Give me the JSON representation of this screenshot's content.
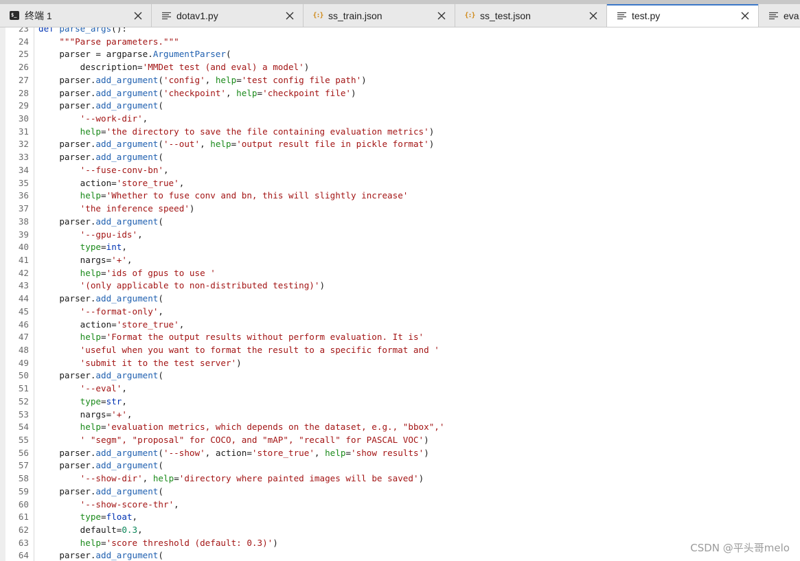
{
  "tabs": [
    {
      "label": "终端 1",
      "icon": "terminal-icon",
      "active": false
    },
    {
      "label": "dotav1.py",
      "icon": "text-file-icon",
      "active": false
    },
    {
      "label": "ss_train.json",
      "icon": "json-file-icon",
      "active": false
    },
    {
      "label": "ss_test.json",
      "icon": "json-file-icon",
      "active": false
    },
    {
      "label": "test.py",
      "icon": "text-file-icon",
      "active": true
    },
    {
      "label": "eva",
      "icon": "text-file-icon",
      "active": false
    }
  ],
  "colors": {
    "keyword": "#0033b3",
    "string": "#a31515",
    "method": "#2060b0",
    "argname": "#1b8a1b",
    "number": "#098658",
    "accent": "#3c78c8"
  },
  "code_lines": [
    {
      "n": "23",
      "t": [
        [
          "kw",
          "def"
        ],
        [
          "txt",
          " "
        ],
        [
          "fn",
          "parse_args"
        ],
        [
          "txt",
          "():"
        ]
      ]
    },
    {
      "n": "24",
      "t": [
        [
          "txt",
          "    "
        ],
        [
          "str",
          "\"\"\"Parse parameters.\"\"\""
        ]
      ]
    },
    {
      "n": "25",
      "t": [
        [
          "txt",
          "    parser = argparse."
        ],
        [
          "fn",
          "ArgumentParser"
        ],
        [
          "txt",
          "("
        ]
      ]
    },
    {
      "n": "26",
      "t": [
        [
          "txt",
          "        description="
        ],
        [
          "str",
          "'MMDet test (and eval) a model'"
        ],
        [
          "txt",
          ")"
        ]
      ]
    },
    {
      "n": "27",
      "t": [
        [
          "txt",
          "    parser."
        ],
        [
          "fn",
          "add_argument"
        ],
        [
          "txt",
          "("
        ],
        [
          "str",
          "'config'"
        ],
        [
          "txt",
          ", "
        ],
        [
          "arg",
          "help"
        ],
        [
          "txt",
          "="
        ],
        [
          "str",
          "'test config file path'"
        ],
        [
          "txt",
          ")"
        ]
      ]
    },
    {
      "n": "28",
      "t": [
        [
          "txt",
          "    parser."
        ],
        [
          "fn",
          "add_argument"
        ],
        [
          "txt",
          "("
        ],
        [
          "str",
          "'checkpoint'"
        ],
        [
          "txt",
          ", "
        ],
        [
          "arg",
          "help"
        ],
        [
          "txt",
          "="
        ],
        [
          "str",
          "'checkpoint file'"
        ],
        [
          "txt",
          ")"
        ]
      ]
    },
    {
      "n": "29",
      "t": [
        [
          "txt",
          "    parser."
        ],
        [
          "fn",
          "add_argument"
        ],
        [
          "txt",
          "("
        ]
      ]
    },
    {
      "n": "30",
      "t": [
        [
          "txt",
          "        "
        ],
        [
          "str",
          "'--work-dir'"
        ],
        [
          "txt",
          ","
        ]
      ]
    },
    {
      "n": "31",
      "t": [
        [
          "txt",
          "        "
        ],
        [
          "arg",
          "help"
        ],
        [
          "txt",
          "="
        ],
        [
          "str",
          "'the directory to save the file containing evaluation metrics'"
        ],
        [
          "txt",
          ")"
        ]
      ]
    },
    {
      "n": "32",
      "t": [
        [
          "txt",
          "    parser."
        ],
        [
          "fn",
          "add_argument"
        ],
        [
          "txt",
          "("
        ],
        [
          "str",
          "'--out'"
        ],
        [
          "txt",
          ", "
        ],
        [
          "arg",
          "help"
        ],
        [
          "txt",
          "="
        ],
        [
          "str",
          "'output result file in pickle format'"
        ],
        [
          "txt",
          ")"
        ]
      ]
    },
    {
      "n": "33",
      "t": [
        [
          "txt",
          "    parser."
        ],
        [
          "fn",
          "add_argument"
        ],
        [
          "txt",
          "("
        ]
      ]
    },
    {
      "n": "34",
      "t": [
        [
          "txt",
          "        "
        ],
        [
          "str",
          "'--fuse-conv-bn'"
        ],
        [
          "txt",
          ","
        ]
      ]
    },
    {
      "n": "35",
      "t": [
        [
          "txt",
          "        action="
        ],
        [
          "str",
          "'store_true'"
        ],
        [
          "txt",
          ","
        ]
      ]
    },
    {
      "n": "36",
      "t": [
        [
          "txt",
          "        "
        ],
        [
          "arg",
          "help"
        ],
        [
          "txt",
          "="
        ],
        [
          "str",
          "'Whether to fuse conv and bn, this will slightly increase'"
        ]
      ]
    },
    {
      "n": "37",
      "t": [
        [
          "txt",
          "        "
        ],
        [
          "str",
          "'the inference speed'"
        ],
        [
          "txt",
          ")"
        ]
      ]
    },
    {
      "n": "38",
      "t": [
        [
          "txt",
          "    parser."
        ],
        [
          "fn",
          "add_argument"
        ],
        [
          "txt",
          "("
        ]
      ]
    },
    {
      "n": "39",
      "t": [
        [
          "txt",
          "        "
        ],
        [
          "str",
          "'--gpu-ids'"
        ],
        [
          "txt",
          ","
        ]
      ]
    },
    {
      "n": "40",
      "t": [
        [
          "txt",
          "        "
        ],
        [
          "arg",
          "type"
        ],
        [
          "txt",
          "="
        ],
        [
          "kw",
          "int"
        ],
        [
          "txt",
          ","
        ]
      ]
    },
    {
      "n": "41",
      "t": [
        [
          "txt",
          "        nargs="
        ],
        [
          "str",
          "'+'"
        ],
        [
          "txt",
          ","
        ]
      ]
    },
    {
      "n": "42",
      "t": [
        [
          "txt",
          "        "
        ],
        [
          "arg",
          "help"
        ],
        [
          "txt",
          "="
        ],
        [
          "str",
          "'ids of gpus to use '"
        ]
      ]
    },
    {
      "n": "43",
      "t": [
        [
          "txt",
          "        "
        ],
        [
          "str",
          "'(only applicable to non-distributed testing)'"
        ],
        [
          "txt",
          ")"
        ]
      ]
    },
    {
      "n": "44",
      "t": [
        [
          "txt",
          "    parser."
        ],
        [
          "fn",
          "add_argument"
        ],
        [
          "txt",
          "("
        ]
      ]
    },
    {
      "n": "45",
      "t": [
        [
          "txt",
          "        "
        ],
        [
          "str",
          "'--format-only'"
        ],
        [
          "txt",
          ","
        ]
      ]
    },
    {
      "n": "46",
      "t": [
        [
          "txt",
          "        action="
        ],
        [
          "str",
          "'store_true'"
        ],
        [
          "txt",
          ","
        ]
      ]
    },
    {
      "n": "47",
      "t": [
        [
          "txt",
          "        "
        ],
        [
          "arg",
          "help"
        ],
        [
          "txt",
          "="
        ],
        [
          "str",
          "'Format the output results without perform evaluation. It is'"
        ]
      ]
    },
    {
      "n": "48",
      "t": [
        [
          "txt",
          "        "
        ],
        [
          "str",
          "'useful when you want to format the result to a specific format and '"
        ]
      ]
    },
    {
      "n": "49",
      "t": [
        [
          "txt",
          "        "
        ],
        [
          "str",
          "'submit it to the test server'"
        ],
        [
          "txt",
          ")"
        ]
      ]
    },
    {
      "n": "50",
      "t": [
        [
          "txt",
          "    parser."
        ],
        [
          "fn",
          "add_argument"
        ],
        [
          "txt",
          "("
        ]
      ]
    },
    {
      "n": "51",
      "t": [
        [
          "txt",
          "        "
        ],
        [
          "str",
          "'--eval'"
        ],
        [
          "txt",
          ","
        ]
      ]
    },
    {
      "n": "52",
      "t": [
        [
          "txt",
          "        "
        ],
        [
          "arg",
          "type"
        ],
        [
          "txt",
          "="
        ],
        [
          "kw",
          "str"
        ],
        [
          "txt",
          ","
        ]
      ]
    },
    {
      "n": "53",
      "t": [
        [
          "txt",
          "        nargs="
        ],
        [
          "str",
          "'+'"
        ],
        [
          "txt",
          ","
        ]
      ]
    },
    {
      "n": "54",
      "t": [
        [
          "txt",
          "        "
        ],
        [
          "arg",
          "help"
        ],
        [
          "txt",
          "="
        ],
        [
          "str",
          "'evaluation metrics, which depends on the dataset, e.g., \"bbox\",'"
        ]
      ]
    },
    {
      "n": "55",
      "t": [
        [
          "txt",
          "        "
        ],
        [
          "str",
          "' \"segm\", \"proposal\" for COCO, and \"mAP\", \"recall\" for PASCAL VOC'"
        ],
        [
          "txt",
          ")"
        ]
      ]
    },
    {
      "n": "56",
      "t": [
        [
          "txt",
          "    parser."
        ],
        [
          "fn",
          "add_argument"
        ],
        [
          "txt",
          "("
        ],
        [
          "str",
          "'--show'"
        ],
        [
          "txt",
          ", action="
        ],
        [
          "str",
          "'store_true'"
        ],
        [
          "txt",
          ", "
        ],
        [
          "arg",
          "help"
        ],
        [
          "txt",
          "="
        ],
        [
          "str",
          "'show results'"
        ],
        [
          "txt",
          ")"
        ]
      ]
    },
    {
      "n": "57",
      "t": [
        [
          "txt",
          "    parser."
        ],
        [
          "fn",
          "add_argument"
        ],
        [
          "txt",
          "("
        ]
      ]
    },
    {
      "n": "58",
      "t": [
        [
          "txt",
          "        "
        ],
        [
          "str",
          "'--show-dir'"
        ],
        [
          "txt",
          ", "
        ],
        [
          "arg",
          "help"
        ],
        [
          "txt",
          "="
        ],
        [
          "str",
          "'directory where painted images will be saved'"
        ],
        [
          "txt",
          ")"
        ]
      ]
    },
    {
      "n": "59",
      "t": [
        [
          "txt",
          "    parser."
        ],
        [
          "fn",
          "add_argument"
        ],
        [
          "txt",
          "("
        ]
      ]
    },
    {
      "n": "60",
      "t": [
        [
          "txt",
          "        "
        ],
        [
          "str",
          "'--show-score-thr'"
        ],
        [
          "txt",
          ","
        ]
      ]
    },
    {
      "n": "61",
      "t": [
        [
          "txt",
          "        "
        ],
        [
          "arg",
          "type"
        ],
        [
          "txt",
          "="
        ],
        [
          "kw",
          "float"
        ],
        [
          "txt",
          ","
        ]
      ]
    },
    {
      "n": "62",
      "t": [
        [
          "txt",
          "        default="
        ],
        [
          "num",
          "0.3"
        ],
        [
          "txt",
          ","
        ]
      ]
    },
    {
      "n": "63",
      "t": [
        [
          "txt",
          "        "
        ],
        [
          "arg",
          "help"
        ],
        [
          "txt",
          "="
        ],
        [
          "str",
          "'score threshold (default: 0.3)'"
        ],
        [
          "txt",
          ")"
        ]
      ]
    },
    {
      "n": "64",
      "t": [
        [
          "txt",
          "    parser."
        ],
        [
          "fn",
          "add_argument"
        ],
        [
          "txt",
          "("
        ]
      ]
    }
  ],
  "watermark": "CSDN @平头哥melo"
}
